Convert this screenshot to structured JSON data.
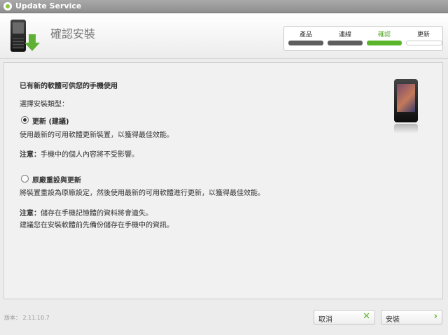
{
  "window": {
    "title": "Update Service"
  },
  "header": {
    "title": "確認安裝"
  },
  "steps": [
    {
      "label": "產品",
      "state": "done"
    },
    {
      "label": "連線",
      "state": "done"
    },
    {
      "label": "確認",
      "state": "active"
    },
    {
      "label": "更新",
      "state": "pending"
    }
  ],
  "content": {
    "heading": "已有新的軟體可供您的手機使用",
    "select_label": "選擇安裝類型：",
    "option_update": {
      "label": "更新 (建議)",
      "desc": "使用最新的可用軟體更新裝置，以獲得最佳效能。",
      "note_prefix": "注意：",
      "note": "手機中的個人內容將不受影響。",
      "selected": true
    },
    "option_reset": {
      "label": "原廠重設與更新",
      "desc": "將裝置重設為原廠設定，然後使用最新的可用軟體進行更新，以獲得最佳效能。",
      "note_prefix": "注意：",
      "note": "儲存在手機記憶體的資料將會遺失。",
      "note2": "建議您在安裝軟體前先備份儲存在手機中的資訊。",
      "selected": false
    }
  },
  "footer": {
    "version": "版本：  2.11.10.7",
    "cancel_label": "取消",
    "install_label": "安裝"
  },
  "icons": {
    "cancel": "x-icon",
    "install": "chevron-right-icon"
  },
  "colors": {
    "accent": "#5bb52b",
    "titlebar": "#9b9b9b",
    "step_done": "#5e5e5e"
  }
}
